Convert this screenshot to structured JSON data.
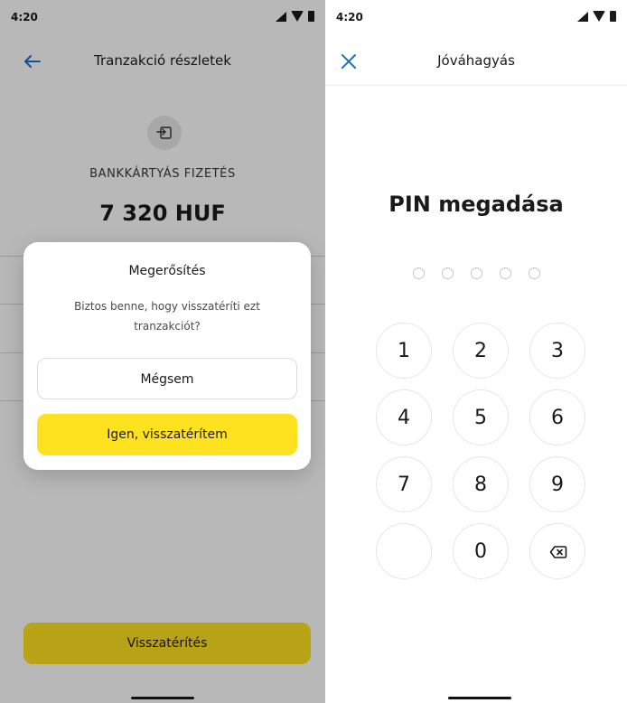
{
  "left_screen": {
    "status_time": "4:20",
    "app_bar_title": "Tranzakció részletek",
    "transaction_type": "BANKKÁRTYÁS FIZETÉS",
    "amount": "7 320 HUF",
    "primary_button_label": "Visszatérítés",
    "dialog": {
      "title": "Megerősítés",
      "message": "Biztos benne, hogy visszatéríti ezt tranzakciót?",
      "cancel_label": "Mégsem",
      "confirm_label": "Igen, visszatérítem"
    }
  },
  "right_screen": {
    "status_time": "4:20",
    "app_bar_title": "Jóváhagyás",
    "pin_title": "PIN megadása",
    "pin_length": 5,
    "keys": {
      "k1": "1",
      "k2": "2",
      "k3": "3",
      "k4": "4",
      "k5": "5",
      "k6": "6",
      "k7": "7",
      "k8": "8",
      "k9": "9",
      "k0": "0"
    }
  },
  "icons": {
    "back": "arrow-left-icon",
    "close": "close-icon",
    "transaction": "card-payment-icon",
    "backspace": "backspace-icon",
    "status": [
      "signal-icon",
      "wifi-icon",
      "battery-icon"
    ]
  },
  "colors": {
    "accent": "#ffe21f",
    "primary_icon": "#1c6fd1",
    "text": "#1a1a1a"
  }
}
